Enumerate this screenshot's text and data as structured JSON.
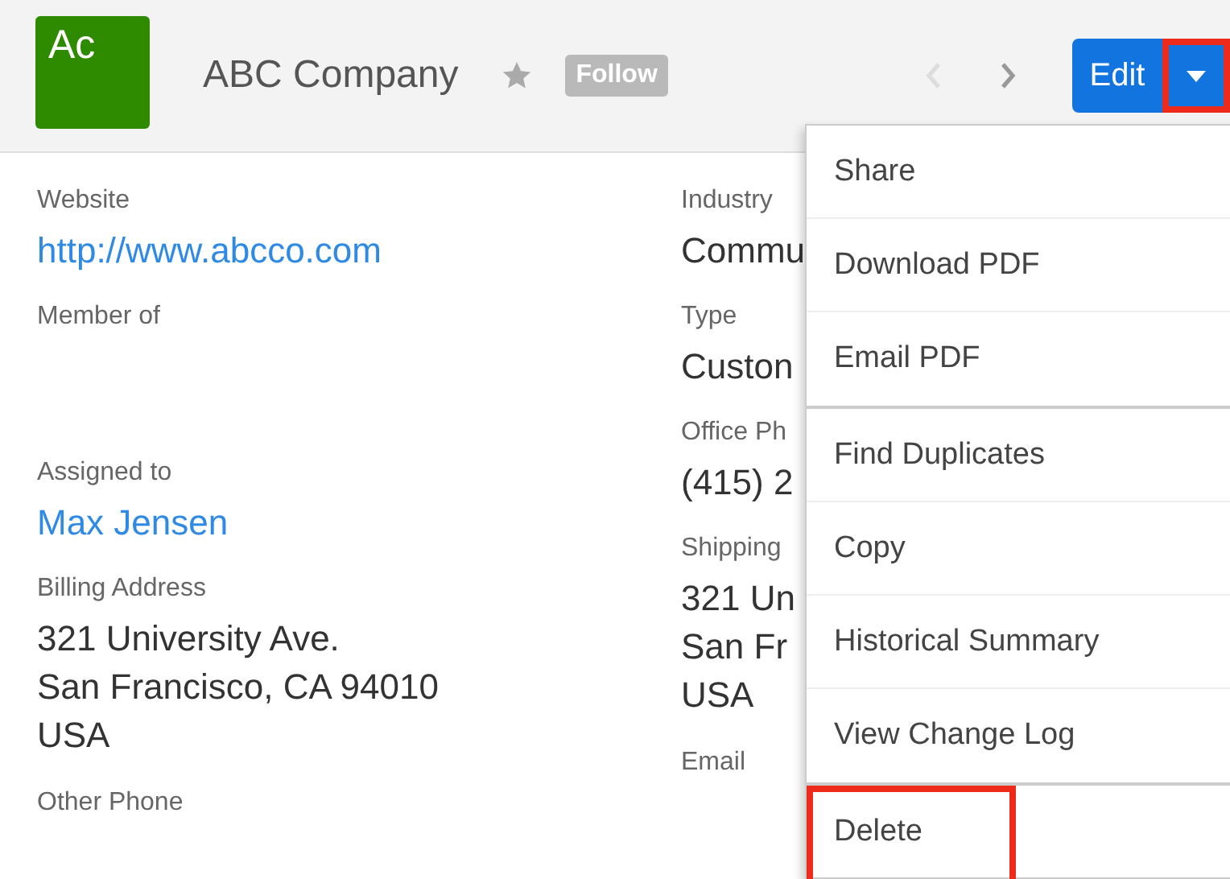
{
  "header": {
    "logo_text": "Ac",
    "title": "ABC Company",
    "starred": false,
    "follow_label": "Follow",
    "prev_disabled": true,
    "next_disabled": false,
    "edit_label": "Edit",
    "caret_highlighted": true
  },
  "left_fields": [
    {
      "label": "Website",
      "value": "http://www.abcco.com",
      "kind": "link"
    },
    {
      "label": "Member of",
      "kind": "text"
    },
    {
      "label": "Assigned to",
      "value": "Max Jensen",
      "kind": "link"
    },
    {
      "label": "Billing Address",
      "lines": [
        "321 University Ave.",
        "San Francisco, CA 94010",
        "USA"
      ],
      "kind": "address"
    },
    {
      "label": "Other Phone",
      "kind": "text"
    }
  ],
  "right_fields": [
    {
      "label": "Industry",
      "value": "Commu",
      "kind": "text"
    },
    {
      "label": "Type",
      "value": "Custon",
      "kind": "text"
    },
    {
      "label": "Office Ph",
      "value": "(415) 2",
      "kind": "text"
    },
    {
      "label": "Shipping",
      "lines": [
        "321 Un",
        "San Fr",
        "USA"
      ],
      "kind": "address"
    },
    {
      "label": "Email",
      "kind": "text"
    }
  ],
  "menu": {
    "groups": [
      [
        {
          "label": "Share",
          "highlighted": false
        },
        {
          "label": "Download PDF",
          "highlighted": false
        },
        {
          "label": "Email PDF",
          "highlighted": false
        }
      ],
      [
        {
          "label": "Find Duplicates",
          "highlighted": false
        },
        {
          "label": "Copy",
          "highlighted": false
        },
        {
          "label": "Historical Summary",
          "highlighted": false
        },
        {
          "label": "View Change Log",
          "highlighted": false
        }
      ],
      [
        {
          "label": "Delete",
          "highlighted": true
        }
      ]
    ]
  }
}
